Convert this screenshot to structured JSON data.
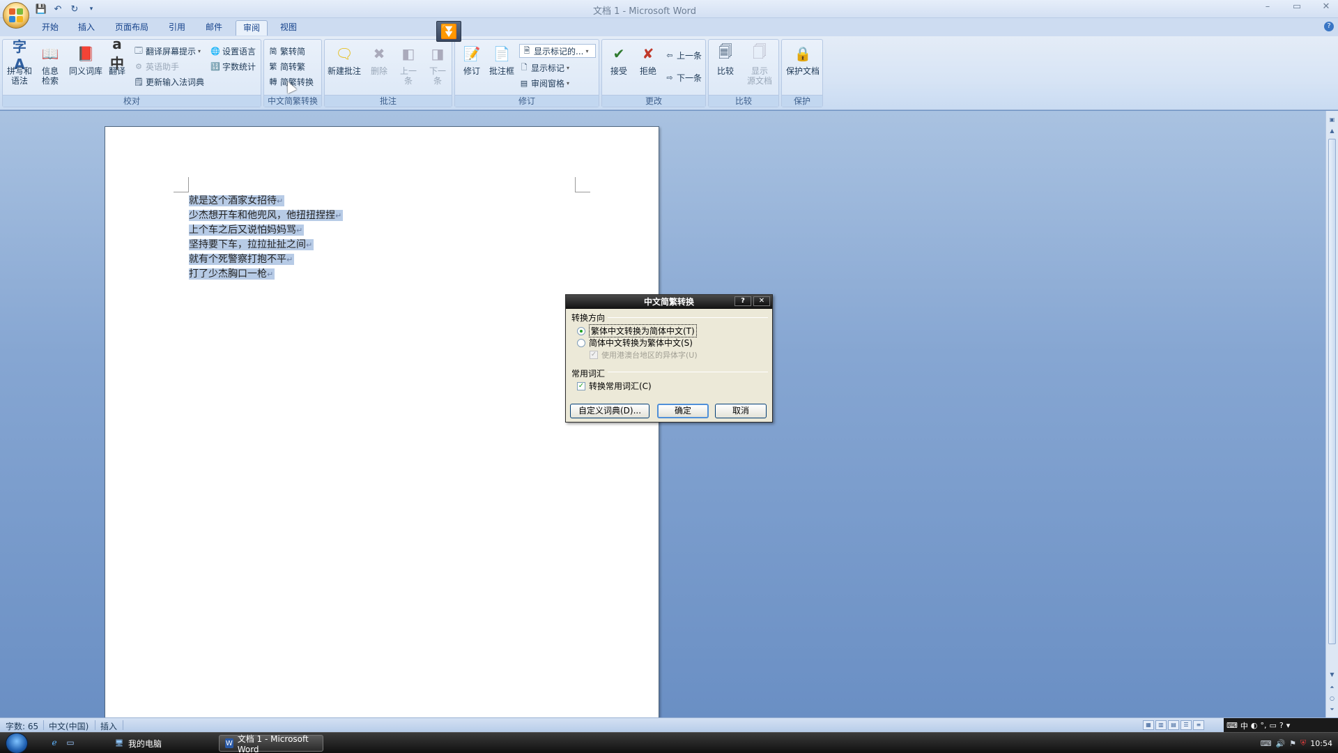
{
  "window": {
    "title": "文档 1 - Microsoft Word",
    "minimize": "–",
    "maximize": "▭",
    "close": "✕"
  },
  "tabs": [
    {
      "label": "开始"
    },
    {
      "label": "插入"
    },
    {
      "label": "页面布局"
    },
    {
      "label": "引用"
    },
    {
      "label": "邮件"
    },
    {
      "label": "审阅"
    },
    {
      "label": "视图"
    }
  ],
  "ribbon": {
    "proofing": {
      "label": "校对",
      "spelling": "拼写和\n语法",
      "research": "信息\n检索",
      "thesaurus": "同义词库",
      "translate": "翻译",
      "translate_tip": "翻译屏幕提示",
      "english_assistant": "英语助手",
      "update_ime": "更新输入法词典",
      "set_language": "设置语言",
      "word_count": "字数统计"
    },
    "chinese_conversion": {
      "label": "中文简繁转换",
      "to_simplified": "繁转简",
      "to_traditional": "简转繁",
      "conversion": "简繁转换"
    },
    "comments": {
      "label": "批注",
      "new_comment": "新建批注",
      "delete": "删除",
      "previous": "上一\n条",
      "next": "下一\n条"
    },
    "tracking": {
      "label": "修订",
      "track_changes": "修订",
      "balloons": "批注框",
      "show_markup_select": "显示标记的...",
      "show_markup": "显示标记",
      "reviewing_pane": "审阅窗格"
    },
    "changes": {
      "label": "更改",
      "accept": "接受",
      "reject": "拒绝",
      "previous": "上一条",
      "next": "下一条"
    },
    "compare": {
      "label": "比较",
      "compare": "比较",
      "show_source": "显示\n源文档"
    },
    "protect": {
      "label": "保护",
      "protect_document": "保护文档"
    }
  },
  "document": {
    "lines": [
      "就是这个酒家女招待",
      "少杰想开车和他兜风，他扭扭捏捏",
      "上个车之后又说怕妈妈骂",
      "坚持要下车，拉拉扯扯之间",
      "就有个死警察打抱不平",
      "打了少杰胸口一枪"
    ],
    "para_mark": "↵"
  },
  "dialog": {
    "title": "中文简繁转换",
    "help": "?",
    "close": "✕",
    "direction_label": "转换方向",
    "opt_trad_to_simp": "繁体中文转换为简体中文(T)",
    "opt_simp_to_trad": "简体中文转换为繁体中文(S)",
    "opt_regional": "使用港澳台地区的异体字(U)",
    "vocab_label": "常用词汇",
    "opt_common_terms": "转换常用词汇(C)",
    "btn_custom_dict": "自定义词典(D)...",
    "btn_ok": "确定",
    "btn_cancel": "取消",
    "selected_direction": "trad_to_simp"
  },
  "statusbar": {
    "word_count": "字数: 65",
    "language": "中文(中国)",
    "mode": "插入"
  },
  "languagebar": {
    "ime": "中",
    "help": "?"
  },
  "taskbar": {
    "my_computer": "我的电脑",
    "word_task": "文档 1 - Microsoft Word",
    "clock": "10:54"
  },
  "colors": {
    "ribbon_bg": "#d7e4f5",
    "workspace_bg": "#86a6d2",
    "selection": "#b7cbe6",
    "dialog_bg": "#ece9d8",
    "dialog_title": "#111111"
  }
}
